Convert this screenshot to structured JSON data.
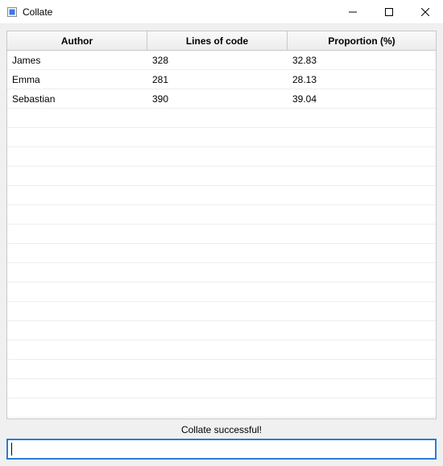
{
  "window": {
    "title": "Collate",
    "min_label": "Minimize",
    "max_label": "Maximize",
    "close_label": "Close"
  },
  "table": {
    "columns": [
      "Author",
      "Lines of code",
      "Proportion (%)"
    ],
    "rows": [
      {
        "author": "James",
        "lines": "328",
        "proportion": "32.83"
      },
      {
        "author": "Emma",
        "lines": "281",
        "proportion": "28.13"
      },
      {
        "author": "Sebastian",
        "lines": "390",
        "proportion": "39.04"
      }
    ],
    "empty_row_count": 16
  },
  "status": {
    "message": "Collate successful!"
  },
  "command_input": {
    "value": "",
    "placeholder": ""
  }
}
